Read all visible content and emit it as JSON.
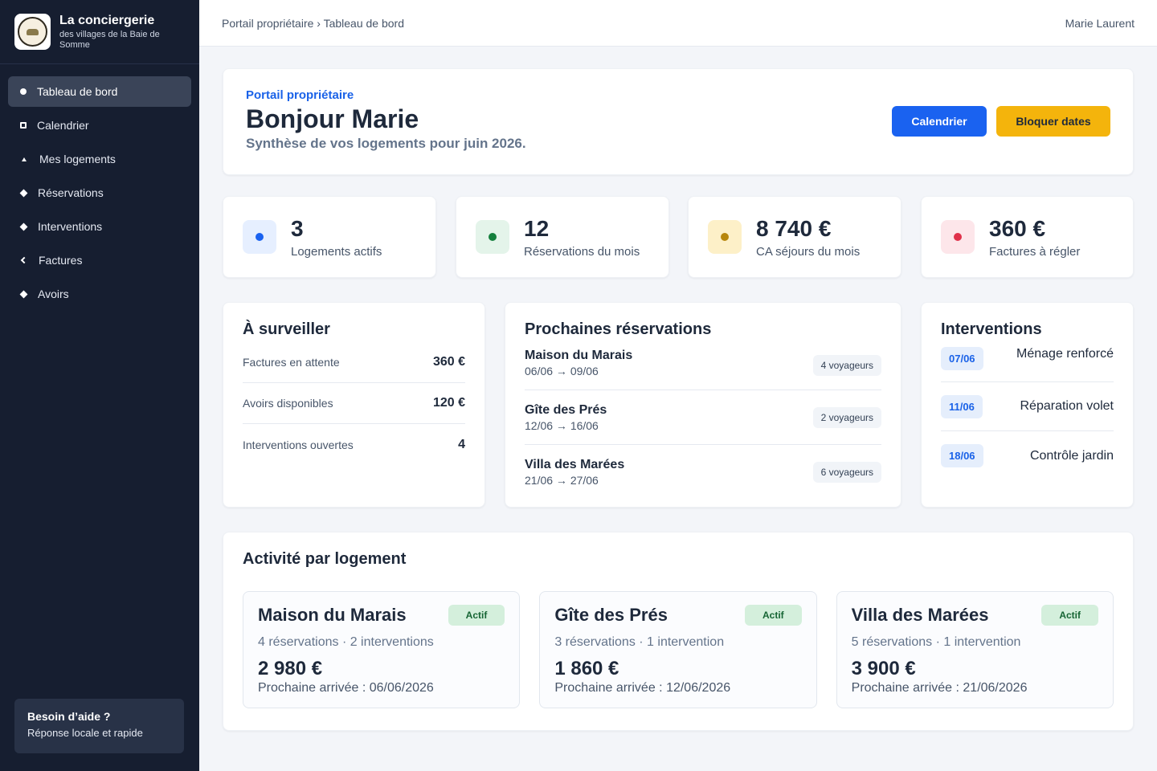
{
  "brand": {
    "title": "La conciergerie",
    "subtitle": "des villages de la Baie de Somme"
  },
  "nav": {
    "items": [
      {
        "label": "Tableau de bord",
        "icon": "dot-icon"
      },
      {
        "label": "Calendrier",
        "icon": "square-icon"
      },
      {
        "label": "Mes logements",
        "icon": "house-icon"
      },
      {
        "label": "Réservations",
        "icon": "diamond-icon"
      },
      {
        "label": "Interventions",
        "icon": "diamond-icon"
      },
      {
        "label": "Factures",
        "icon": "chevron-left-icon"
      },
      {
        "label": "Avoirs",
        "icon": "diamond-icon"
      }
    ]
  },
  "help": {
    "title": "Besoin d’aide ?",
    "subtitle": "Réponse locale et rapide"
  },
  "topbar": {
    "breadcrumb": "Portail propriétaire › Tableau de bord",
    "user": "Marie Laurent"
  },
  "hero": {
    "kicker": "Portail propriétaire",
    "title": "Bonjour Marie",
    "subtitle": "Synthèse de vos logements pour juin 2026.",
    "calendar_btn": "Calendrier",
    "block_btn": "Bloquer dates"
  },
  "stats": [
    {
      "value": "3",
      "label": "Logements actifs",
      "bg": "#e6efff",
      "dot": "#1a62f0"
    },
    {
      "value": "12",
      "label": "Réservations du mois",
      "bg": "#e4f4ea",
      "dot": "#15803d"
    },
    {
      "value": "8 740 €",
      "label": "CA séjours du mois",
      "bg": "#fdf0c8",
      "dot": "#b7860b"
    },
    {
      "value": "360 €",
      "label": "Factures à régler",
      "bg": "#fde6ea",
      "dot": "#e0314a"
    }
  ],
  "watch": {
    "title": "À surveiller",
    "rows": [
      {
        "label": "Factures en attente",
        "value": "360 €"
      },
      {
        "label": "Avoirs disponibles",
        "value": "120 €"
      },
      {
        "label": "Interventions ouvertes",
        "value": "4"
      }
    ]
  },
  "reservations": {
    "title": "Prochaines réservations",
    "rows": [
      {
        "name": "Maison du Marais",
        "dates": "06/06 → 09/06",
        "guests": "4 voyageurs"
      },
      {
        "name": "Gîte des Prés",
        "dates": "12/06 → 16/06",
        "guests": "2 voyageurs"
      },
      {
        "name": "Villa des Marées",
        "dates": "21/06 → 27/06",
        "guests": "6 voyageurs"
      }
    ]
  },
  "interventions": {
    "title": "Interventions",
    "rows": [
      {
        "date": "07/06",
        "label": "Ménage renforcé"
      },
      {
        "date": "11/06",
        "label": "Réparation volet"
      },
      {
        "date": "18/06",
        "label": "Contrôle jardin"
      }
    ]
  },
  "activity": {
    "title": "Activité par logement",
    "properties": [
      {
        "name": "Maison du Marais",
        "status": "Actif",
        "meta": "4 réservations · 2 interventions",
        "amount": "2 980 €",
        "next": "Prochaine arrivée : 06/06/2026"
      },
      {
        "name": "Gîte des Prés",
        "status": "Actif",
        "meta": "3 réservations · 1 intervention",
        "amount": "1 860 €",
        "next": "Prochaine arrivée : 12/06/2026"
      },
      {
        "name": "Villa des Marées",
        "status": "Actif",
        "meta": "5 réservations · 1 intervention",
        "amount": "3 900 €",
        "next": "Prochaine arrivée : 21/06/2026"
      }
    ]
  }
}
